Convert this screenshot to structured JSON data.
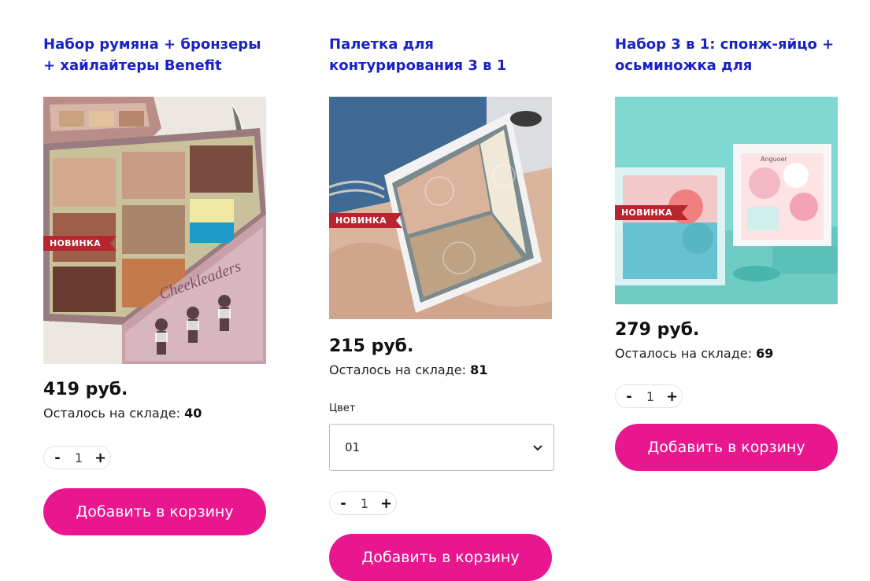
{
  "products": [
    {
      "title": "Набор румяна + бронзеры + хайлайтеры Benefit",
      "badge": "НОВИНКА",
      "price": "419 руб.",
      "stock_label": "Осталось на складе:",
      "stock_count": "40",
      "qty_minus": "-",
      "qty_value": "1",
      "qty_plus": "+",
      "cart_label": "Добавить в корзину"
    },
    {
      "title": "Палетка для контурирования 3 в 1",
      "badge": "НОВИНКА",
      "price": "215 руб.",
      "stock_label": "Осталось на складе:",
      "stock_count": "81",
      "option_label": "Цвет",
      "option_value": "01",
      "qty_minus": "-",
      "qty_value": "1",
      "qty_plus": "+",
      "cart_label": "Добавить в корзину"
    },
    {
      "title": "Набор 3 в 1: спонж-яйцо + осьминожка для",
      "badge": "НОВИНКА",
      "price": "279 руб.",
      "stock_label": "Осталось на складе:",
      "stock_count": "69",
      "qty_minus": "-",
      "qty_value": "1",
      "qty_plus": "+",
      "cart_label": "Добавить в корзину"
    }
  ],
  "colors": {
    "title": "#1a22c7",
    "badge": "#b7262f",
    "cart_button": "#e8168f"
  }
}
